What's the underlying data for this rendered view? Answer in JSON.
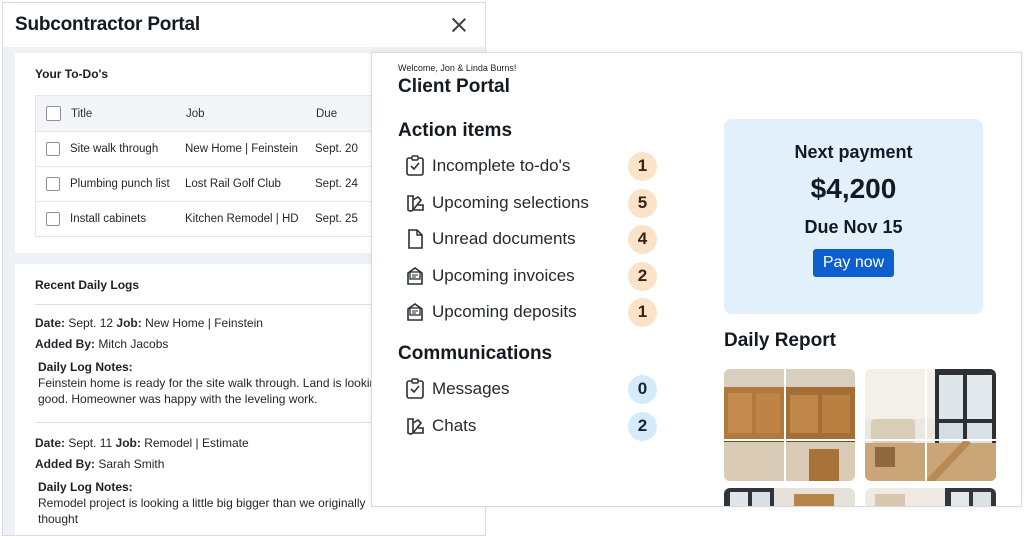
{
  "subcontractor": {
    "title": "Subcontractor Portal",
    "todo": {
      "heading": "Your To-Do's",
      "columns": {
        "title": "Title",
        "job": "Job",
        "due": "Due"
      },
      "rows": [
        {
          "title": "Site walk through",
          "job": "New Home | Feinstein",
          "due": "Sept. 20"
        },
        {
          "title": "Plumbing punch list",
          "job": "Lost Rail Golf Club",
          "due": "Sept. 24"
        },
        {
          "title": "Install cabinets",
          "job": "Kitchen Remodel | HD",
          "due": "Sept. 25"
        }
      ]
    },
    "logs": {
      "heading": "Recent Daily Logs",
      "labels": {
        "date": "Date:",
        "job": "Job:",
        "added_by": "Added By:",
        "notes": "Daily Log Notes:"
      },
      "entries": [
        {
          "date": "Sept. 12",
          "job": "New Home | Feinstein",
          "added_by": "Mitch Jacobs",
          "notes": "Feinstein home is ready for the site walk through. Land is looking good. Homeowner was happy with the leveling work."
        },
        {
          "date": "Sept. 11",
          "job": "Remodel | Estimate",
          "added_by": "Sarah Smith",
          "notes": "Remodel project is looking a little big bigger than we originally thought"
        }
      ]
    }
  },
  "client": {
    "welcome": "Welcome, Jon & Linda Burns!",
    "title": "Client Portal",
    "action_items": {
      "heading": "Action items",
      "items": [
        {
          "label": "Incomplete to-do's",
          "count": "1",
          "icon": "checklist-icon"
        },
        {
          "label": "Upcoming selections",
          "count": "5",
          "icon": "swatch-icon"
        },
        {
          "label": "Unread documents",
          "count": "4",
          "icon": "document-icon"
        },
        {
          "label": "Upcoming invoices",
          "count": "2",
          "icon": "invoice-icon"
        },
        {
          "label": "Upcoming deposits",
          "count": "1",
          "icon": "invoice-icon"
        }
      ]
    },
    "communications": {
      "heading": "Communications",
      "items": [
        {
          "label": "Messages",
          "count": "0",
          "icon": "checklist-icon"
        },
        {
          "label": "Chats",
          "count": "2",
          "icon": "swatch-icon"
        }
      ]
    },
    "payment": {
      "label": "Next payment",
      "amount": "$4,200",
      "due": "Due Nov 15",
      "button": "Pay now"
    },
    "daily_report": {
      "heading": "Daily Report"
    }
  },
  "colors": {
    "accent": "#0b5fcf",
    "payment_bg": "#e2f0fb",
    "badge_warm": "#fbe3c9",
    "badge_cool": "#d6ebfa"
  }
}
